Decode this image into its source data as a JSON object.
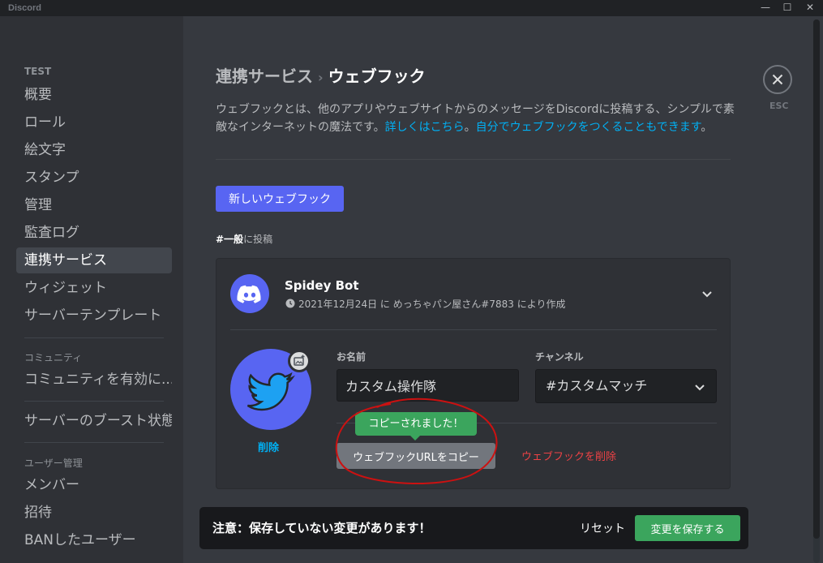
{
  "titlebar": {
    "app_name": "Discord",
    "minimize": "—",
    "maximize": "☐",
    "close": "✕"
  },
  "sidebar": {
    "server_section": "TEST",
    "items": [
      "概要",
      "ロール",
      "絵文字",
      "スタンプ",
      "管理",
      "監査ログ",
      "連携サービス",
      "ウィジェット",
      "サーバーテンプレート"
    ],
    "active": "連携サービス",
    "community_section": "コミュニティ",
    "community_item": "コミュニティを有効に...",
    "boost_item": "サーバーのブースト状態",
    "user_section": "ユーザー管理",
    "user_items": [
      "メンバー",
      "招待",
      "BANしたユーザー"
    ]
  },
  "breadcrumb": {
    "parent": "連携サービス",
    "separator": "›",
    "current": "ウェブフック"
  },
  "description": {
    "text": "ウェブフックとは、他のアプリやウェブサイトからのメッセージをDiscordに投稿する、シンプルで素敵なインターネットの魔法です。",
    "link1": "詳しくはこちら",
    "mid": "。",
    "link2": "自分でウェブフックをつくることもできます",
    "end": "。"
  },
  "new_webhook_button": "新しいウェブフック",
  "post_label": {
    "channel": "#一般",
    "suffix": "に投稿"
  },
  "webhook": {
    "name": "Spidey Bot",
    "meta": "2021年12月24日 に めっちゃパン屋さん#7883 により作成",
    "delete_avatar": "削除",
    "name_label": "お名前",
    "name_value": "カスタム操作隊",
    "channel_label": "チャンネル",
    "channel_value": "#カスタムマッチ",
    "tooltip": "コピーされました！",
    "copy_button": "ウェブフックURLをコピー",
    "delete_button": "ウェブフックを削除"
  },
  "notice": {
    "text": "注意：保存していない変更があります！",
    "reset": "リセット",
    "save": "変更を保存する"
  },
  "close": {
    "label": "ESC"
  },
  "colors": {
    "blurple": "#5865f2",
    "green": "#3ba55d",
    "red": "#ed4245",
    "link": "#00b0f4",
    "annotation": "#cc1111"
  }
}
